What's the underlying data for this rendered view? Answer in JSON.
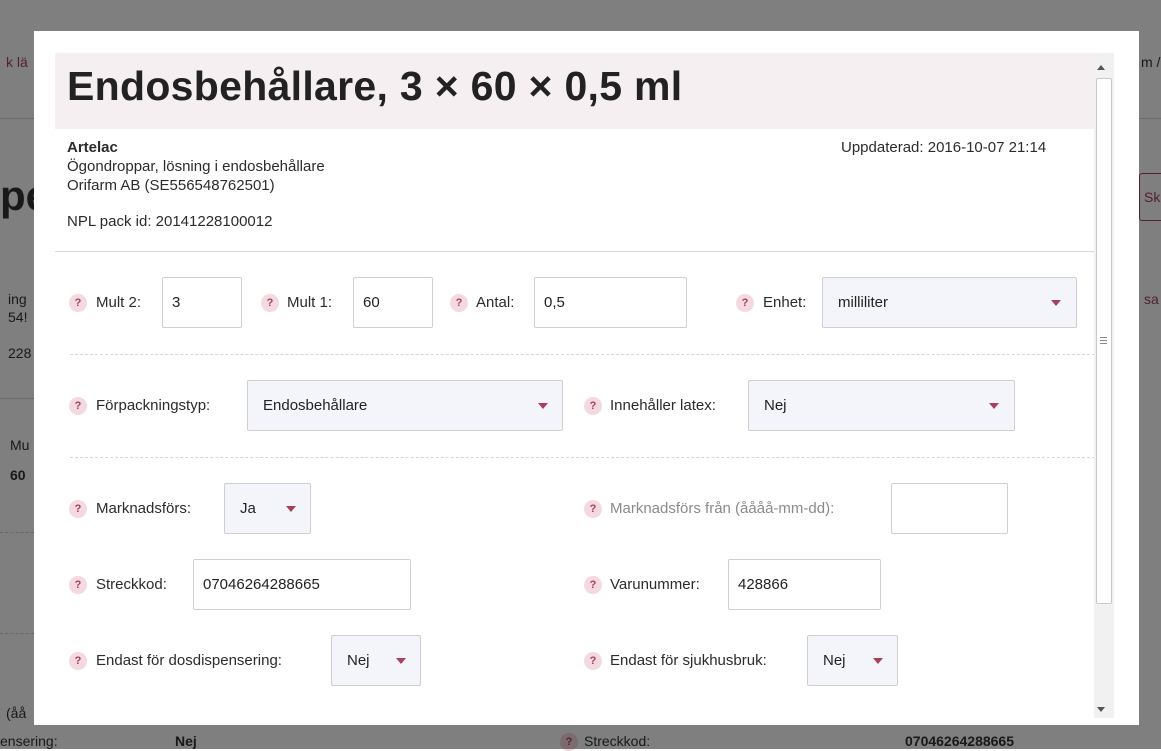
{
  "background": {
    "left_fragments": [
      "k lä",
      "pe",
      "ing",
      "54!",
      "228",
      "Mu",
      "60",
      "(åå",
      "ensering:"
    ],
    "right_fragments": [
      "m /",
      "Sk",
      "sa"
    ],
    "bottom_row": {
      "value_nej": "Nej",
      "streckkod_label": "Streckkod:",
      "streckkod_value": "07046264288665"
    }
  },
  "modal": {
    "title": "Endosbehållare, 3 × 60 × 0,5 ml",
    "brand": "Artelac",
    "description": "Ögondroppar, lösning i endosbehållare",
    "company": "Orifarm AB (SE556548762501)",
    "npl_pack_id": "NPL pack id: 20141228100012",
    "updated": "Uppdaterad: 2016-10-07 21:14",
    "help_glyph": "?",
    "fields": {
      "mult2": {
        "label": "Mult 2:",
        "value": "3"
      },
      "mult1": {
        "label": "Mult 1:",
        "value": "60"
      },
      "antal": {
        "label": "Antal:",
        "value": "0,5"
      },
      "enhet": {
        "label": "Enhet:",
        "value": "milliliter"
      },
      "forpackningstyp": {
        "label": "Förpackningstyp:",
        "value": "Endosbehållare"
      },
      "latex": {
        "label": "Innehåller latex:",
        "value": "Nej"
      },
      "marknadsfors": {
        "label": "Marknadsförs:",
        "value": "Ja"
      },
      "marknadsfors_fran": {
        "label": "Marknadsförs från (åååå-mm-dd):",
        "value": ""
      },
      "streckkod": {
        "label": "Streckkod:",
        "value": "07046264288665"
      },
      "varunummer": {
        "label": "Varunummer:",
        "value": "428866"
      },
      "dosdispensering": {
        "label": "Endast för dosdispensering:",
        "value": "Nej"
      },
      "sjukhusbruk": {
        "label": "Endast för sjukhusbruk:",
        "value": "Nej"
      }
    }
  },
  "colors": {
    "accent": "#a8405b",
    "help_bg": "#f5d9e0",
    "title_band": "#f6eff2",
    "select_bg": "#f4f5fb"
  }
}
